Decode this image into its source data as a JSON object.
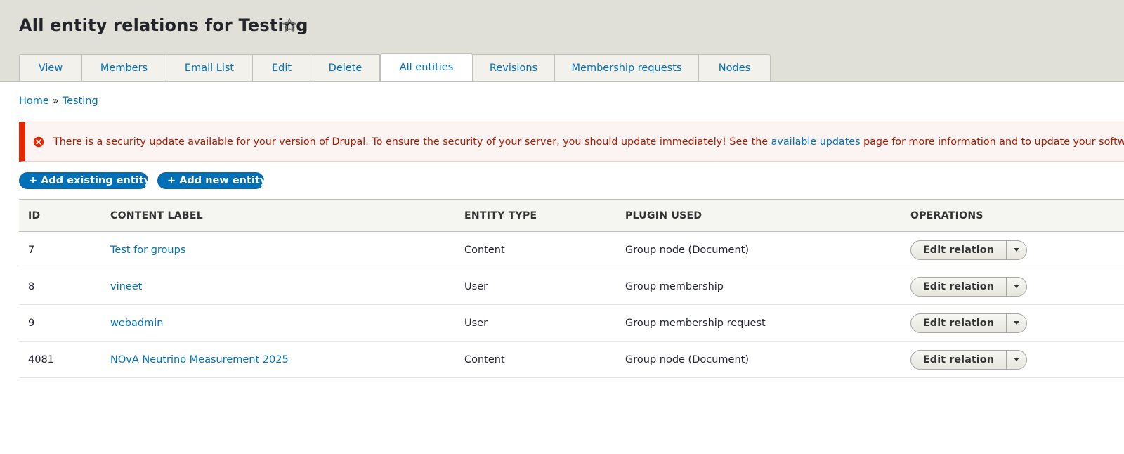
{
  "page": {
    "title": "All entity relations for Testing",
    "favorite_icon": "star-outline-icon"
  },
  "tabs": [
    {
      "label": "View",
      "active": false
    },
    {
      "label": "Members",
      "active": false
    },
    {
      "label": "Email List",
      "active": false
    },
    {
      "label": "Edit",
      "active": false
    },
    {
      "label": "Delete",
      "active": false
    },
    {
      "label": "All entities",
      "active": true
    },
    {
      "label": "Revisions",
      "active": false
    },
    {
      "label": "Membership requests",
      "active": false
    },
    {
      "label": "Nodes",
      "active": false
    }
  ],
  "breadcrumb": {
    "home": "Home",
    "separator": "»",
    "current": "Testing"
  },
  "message": {
    "type": "error",
    "icon": "error-circle-icon",
    "text_before": "There is a security update available for your version of Drupal. To ensure the security of your server, you should update immediately! See the",
    "link_text": "available updates",
    "text_after": "page for more information and to update your software."
  },
  "actions": {
    "add_existing": "+ Add existing entity",
    "add_new": "+ Add new entity"
  },
  "table": {
    "headers": {
      "id": "ID",
      "label": "CONTENT LABEL",
      "type": "ENTITY TYPE",
      "plugin": "PLUGIN USED",
      "operations": "OPERATIONS"
    },
    "rows": [
      {
        "id": "7",
        "label": "Test for groups",
        "type": "Content",
        "plugin": "Group node (Document)",
        "operation": "Edit relation"
      },
      {
        "id": "8",
        "label": "vineet",
        "type": "User",
        "plugin": "Group membership",
        "operation": "Edit relation"
      },
      {
        "id": "9",
        "label": "webadmin",
        "type": "User",
        "plugin": "Group membership request",
        "operation": "Edit relation"
      },
      {
        "id": "4081",
        "label": "NOvA Neutrino Measurement 2025",
        "type": "Content",
        "plugin": "Group node (Document)",
        "operation": "Edit relation"
      }
    ]
  },
  "colors": {
    "link": "#0071b8",
    "error_border": "#e62600",
    "error_text": "#a51b00",
    "header_bg": "#e0e0d8",
    "primary_button": "#0071b8"
  }
}
